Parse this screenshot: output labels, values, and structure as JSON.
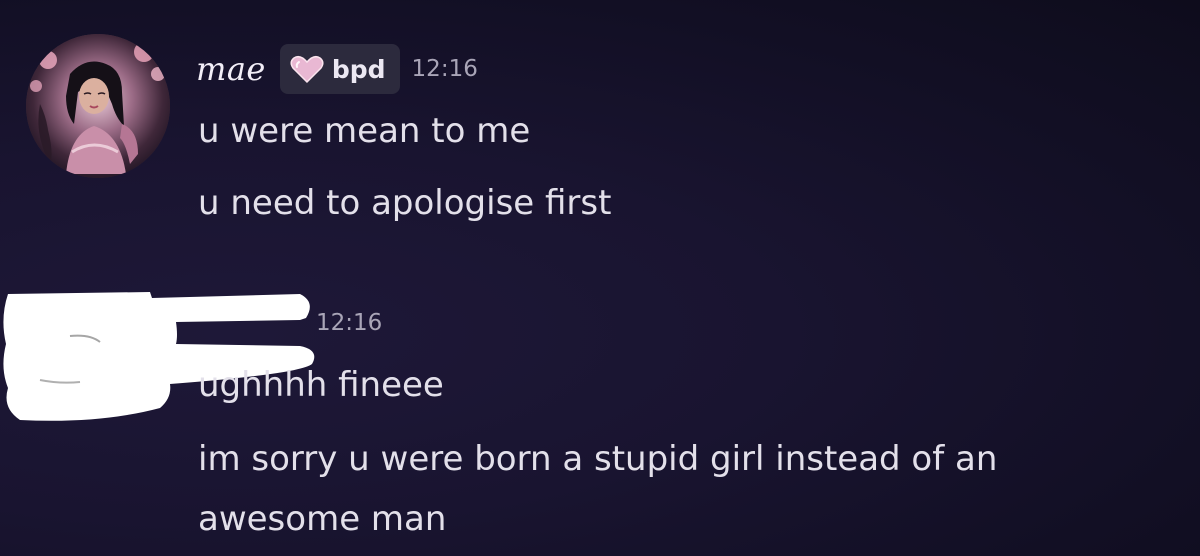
{
  "messages": [
    {
      "author": "mae",
      "role": {
        "name": "bpd",
        "icon": "pink-heart-icon",
        "color": "#e9b8d3"
      },
      "timestamp": "12:16",
      "lines": [
        "u were mean to me",
        "u need to apologise first"
      ]
    },
    {
      "author": "",
      "timestamp": "12:16",
      "lines": [
        "ughhhh fineee",
        "im sorry u were born a stupid girl instead of an",
        "awesome man"
      ]
    }
  ],
  "colors": {
    "background": "#191430",
    "message_text": "#e3e0ea",
    "timestamp": "#a9a5b7",
    "role_tag_background": "#2c2a3d"
  }
}
